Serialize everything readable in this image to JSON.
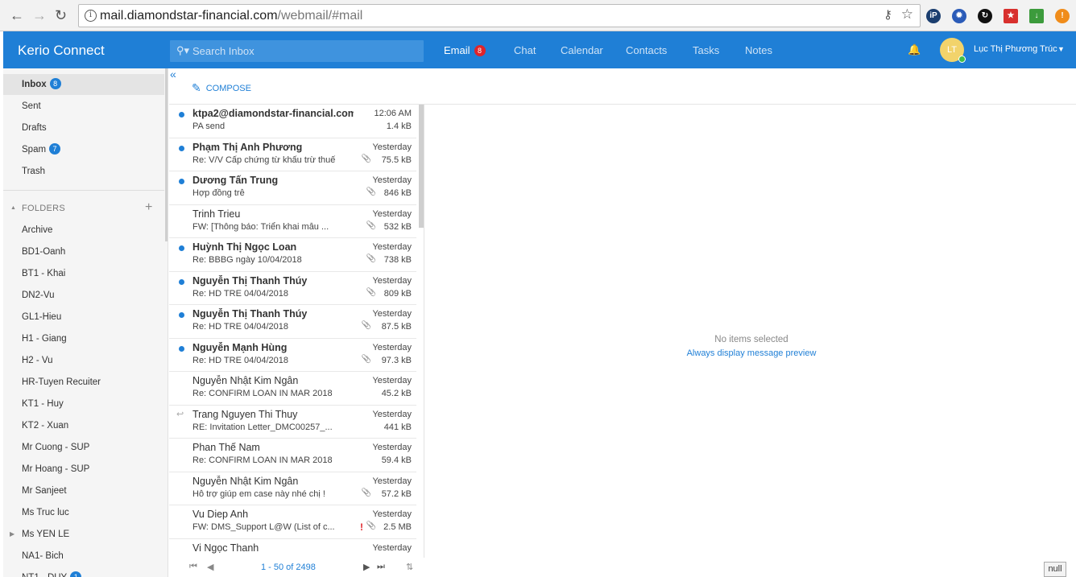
{
  "browser": {
    "url_host": "mail.diamondstar-financial.com",
    "url_path": "/webmail/#mail"
  },
  "header": {
    "brand": "Kerio Connect",
    "search_placeholder": "Search Inbox",
    "tabs": [
      {
        "label": "Email",
        "badge": "8"
      },
      {
        "label": "Chat"
      },
      {
        "label": "Calendar"
      },
      {
        "label": "Contacts"
      },
      {
        "label": "Tasks"
      },
      {
        "label": "Notes"
      }
    ],
    "avatar_initials": "LT",
    "user_name": "Lục Thị Phương Trúc"
  },
  "sidebar": {
    "mailboxes": [
      {
        "label": "Inbox",
        "badge": "8"
      },
      {
        "label": "Sent"
      },
      {
        "label": "Drafts"
      },
      {
        "label": "Spam",
        "badge": "7"
      },
      {
        "label": "Trash"
      }
    ],
    "folders_heading": "FOLDERS",
    "folders": [
      {
        "label": "Archive"
      },
      {
        "label": "BD1-Oanh"
      },
      {
        "label": "BT1 - Khai"
      },
      {
        "label": "DN2-Vu"
      },
      {
        "label": "GL1-Hieu"
      },
      {
        "label": "H1 - Giang"
      },
      {
        "label": "H2 - Vu"
      },
      {
        "label": "HR-Tuyen Recuiter"
      },
      {
        "label": "KT1 - Huy"
      },
      {
        "label": "KT2 - Xuan"
      },
      {
        "label": "Mr Cuong - SUP"
      },
      {
        "label": "Mr Hoang - SUP"
      },
      {
        "label": "Mr Sanjeet"
      },
      {
        "label": "Ms Truc luc"
      },
      {
        "label": "Ms YEN LE",
        "expandable": true
      },
      {
        "label": "NA1- Bich"
      },
      {
        "label": "NT1 - DUY",
        "badge": "1"
      }
    ]
  },
  "toolbar": {
    "compose_label": "COMPOSE"
  },
  "messages": [
    {
      "from": "ktpa2@diamondstar-financial.com",
      "subject": "PA send",
      "time": "12:06 AM",
      "size": "1.4 kB",
      "unread": true,
      "attachment": false
    },
    {
      "from": "Phạm Thị Anh Phương",
      "subject": "Re: V/V Cấp chứng từ khấu trừ thuế",
      "time": "Yesterday",
      "size": "75.5 kB",
      "unread": true,
      "attachment": true
    },
    {
      "from": "Dương Tấn Trung",
      "subject": "Hợp đồng trễ",
      "time": "Yesterday",
      "size": "846 kB",
      "unread": true,
      "attachment": true
    },
    {
      "from": "Trinh Trieu",
      "subject": "FW: [Thông báo: Triển khai mẫu ...",
      "time": "Yesterday",
      "size": "532 kB",
      "unread": false,
      "attachment": true
    },
    {
      "from": "Huỳnh Thị Ngọc Loan",
      "subject": "Re: BBBG ngày 10/04/2018",
      "time": "Yesterday",
      "size": "738 kB",
      "unread": true,
      "attachment": true
    },
    {
      "from": "Nguyễn Thị Thanh Thúy",
      "subject": "Re: HD TRE 04/04/2018",
      "time": "Yesterday",
      "size": "809 kB",
      "unread": true,
      "attachment": true
    },
    {
      "from": "Nguyễn Thị Thanh Thúy",
      "subject": "Re: HD TRE 04/04/2018",
      "time": "Yesterday",
      "size": "87.5 kB",
      "unread": true,
      "attachment": true
    },
    {
      "from": "Nguyễn Mạnh Hùng",
      "subject": "Re: HD TRE 04/04/2018",
      "time": "Yesterday",
      "size": "97.3 kB",
      "unread": true,
      "attachment": true
    },
    {
      "from": "Nguyễn Nhật Kim Ngân",
      "subject": "Re: CONFIRM LOAN IN MAR 2018",
      "time": "Yesterday",
      "size": "45.2 kB",
      "unread": false,
      "attachment": false
    },
    {
      "from": "Trang Nguyen Thi Thuy",
      "subject": "RE: Invitation Letter_DMC00257_...",
      "time": "Yesterday",
      "size": "441 kB",
      "unread": false,
      "attachment": false,
      "replied": true
    },
    {
      "from": "Phan Thế Nam",
      "subject": "Re: CONFIRM LOAN IN MAR 2018",
      "time": "Yesterday",
      "size": "59.4 kB",
      "unread": false,
      "attachment": false
    },
    {
      "from": "Nguyễn Nhật Kim Ngân",
      "subject": "Hỗ trợ giúp em case này nhé chị !",
      "time": "Yesterday",
      "size": "57.2 kB",
      "unread": false,
      "attachment": true
    },
    {
      "from": "Vu Diep Anh",
      "subject": "FW: DMS_Support L@W (List of c...",
      "time": "Yesterday",
      "size": "2.5 MB",
      "unread": false,
      "attachment": true,
      "important": true
    },
    {
      "from": "Vi Ngọc Thanh",
      "subject": "",
      "time": "Yesterday",
      "size": "",
      "unread": false,
      "attachment": false
    }
  ],
  "pager": {
    "count_text": "1 - 50 of 2498"
  },
  "preview": {
    "empty_text": "No items selected",
    "link_text": "Always display message preview"
  },
  "footer": {
    "null_label": "null"
  },
  "colors": {
    "accent": "#1f7fd6",
    "badge_red": "#e0242a"
  }
}
